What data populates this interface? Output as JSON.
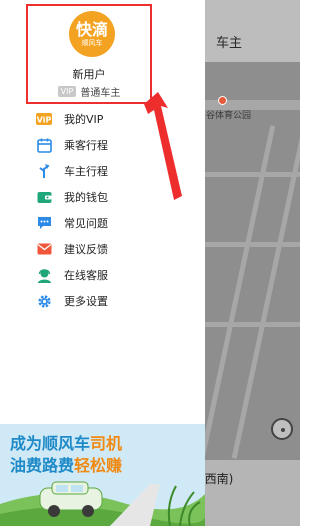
{
  "map": {
    "header_title": "车主",
    "poi_label": "谷体育公园",
    "bottom_location": "(西南)"
  },
  "profile": {
    "logo_main": "快滴",
    "logo_sub": "顺风车",
    "username": "新用户",
    "vip_tag": "VIP",
    "member_level": "普通车主"
  },
  "menu": {
    "items": [
      {
        "label": "我的VIP",
        "icon": "vip-icon"
      },
      {
        "label": "乘客行程",
        "icon": "calendar-icon"
      },
      {
        "label": "车主行程",
        "icon": "route-icon"
      },
      {
        "label": "我的钱包",
        "icon": "wallet-icon"
      },
      {
        "label": "常见问题",
        "icon": "chat-icon"
      },
      {
        "label": "建议反馈",
        "icon": "mail-icon"
      },
      {
        "label": "在线客服",
        "icon": "agent-icon"
      },
      {
        "label": "更多设置",
        "icon": "gear-icon"
      }
    ]
  },
  "banner": {
    "line1_pre": "成为顺风车",
    "line1_hl": "司机",
    "line2_pre": "油费路费",
    "line2_hl": "轻松赚"
  },
  "colors": {
    "accent_orange": "#f3a321",
    "callout_red": "#ee2d2d",
    "icon_blue": "#2b8be6"
  }
}
